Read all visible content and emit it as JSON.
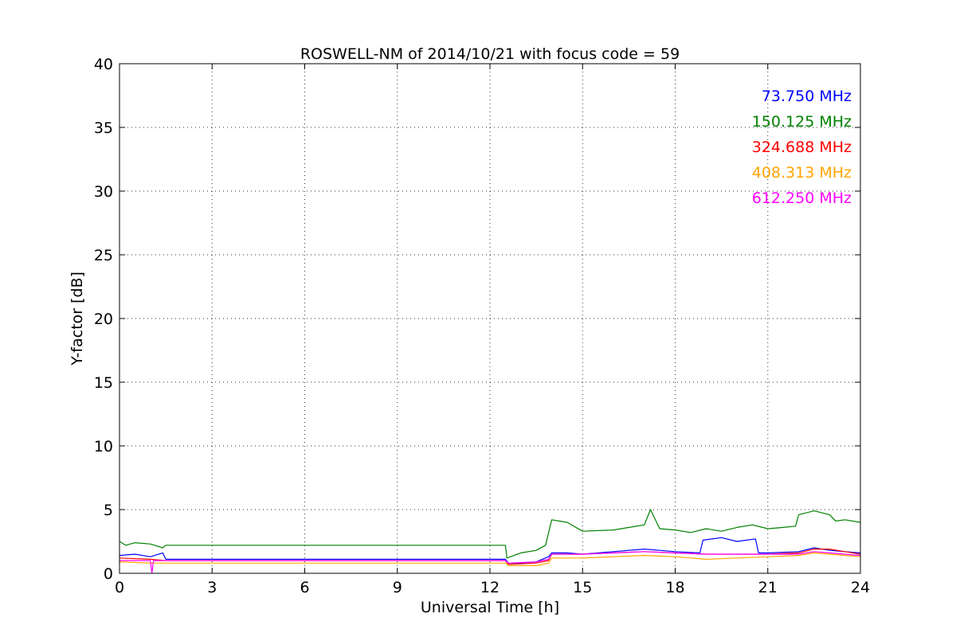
{
  "chart_data": {
    "type": "line",
    "title": "ROSWELL-NM of 2014/10/21 with focus code = 59",
    "xlabel": "Universal Time [h]",
    "ylabel": "Y-factor [dB]",
    "xlim": [
      0,
      24
    ],
    "ylim": [
      0,
      40
    ],
    "xticks": [
      0,
      3,
      6,
      9,
      12,
      15,
      18,
      21,
      24
    ],
    "yticks": [
      0,
      5,
      10,
      15,
      20,
      25,
      30,
      35,
      40
    ],
    "xtick_labels": [
      "0",
      "3",
      "6",
      "9",
      "12",
      "15",
      "18",
      "21",
      "24"
    ],
    "ytick_labels": [
      "0",
      "5",
      "10",
      "15",
      "20",
      "25",
      "30",
      "35",
      "40"
    ],
    "grid": true,
    "legend_position": "top-right",
    "series": [
      {
        "name": "73.750 MHz",
        "color": "#0000ff",
        "x": [
          0,
          0.5,
          1.0,
          1.4,
          1.5,
          12.5,
          12.6,
          13.0,
          13.5,
          13.9,
          14.0,
          14.5,
          15.0,
          16.0,
          17.0,
          17.5,
          18.0,
          18.8,
          18.9,
          19.5,
          20.0,
          20.6,
          20.7,
          21.0,
          22.0,
          22.5,
          23.0,
          23.5,
          24.0
        ],
        "y": [
          1.4,
          1.5,
          1.3,
          1.6,
          1.1,
          1.1,
          0.8,
          0.8,
          0.9,
          1.3,
          1.6,
          1.6,
          1.5,
          1.7,
          1.9,
          1.8,
          1.7,
          1.6,
          2.6,
          2.8,
          2.5,
          2.7,
          1.6,
          1.6,
          1.7,
          2.0,
          1.8,
          1.7,
          1.6
        ]
      },
      {
        "name": "150.125 MHz",
        "color": "#008000",
        "x": [
          0,
          0.2,
          0.5,
          1.0,
          1.4,
          1.5,
          12.5,
          12.55,
          13.0,
          13.5,
          13.8,
          14.0,
          14.5,
          15.0,
          16.0,
          16.5,
          17.0,
          17.2,
          17.5,
          18.0,
          18.5,
          19.0,
          19.5,
          20.0,
          20.5,
          21.0,
          21.5,
          21.9,
          22.0,
          22.5,
          23.0,
          23.2,
          23.5,
          24.0
        ],
        "y": [
          2.5,
          2.2,
          2.4,
          2.3,
          2.0,
          2.2,
          2.2,
          1.2,
          1.6,
          1.8,
          2.2,
          4.2,
          4.0,
          3.3,
          3.4,
          3.6,
          3.8,
          5.0,
          3.5,
          3.4,
          3.2,
          3.5,
          3.3,
          3.6,
          3.8,
          3.5,
          3.6,
          3.7,
          4.6,
          4.9,
          4.6,
          4.1,
          4.2,
          4.0
        ]
      },
      {
        "name": "324.688 MHz",
        "color": "#ff0000",
        "x": [
          0,
          1.0,
          1.5,
          12.5,
          12.6,
          13.5,
          13.9,
          14.0,
          15.0,
          16.0,
          17.0,
          18.0,
          19.0,
          20.0,
          21.0,
          22.0,
          22.5,
          23.0,
          23.5,
          24.0
        ],
        "y": [
          1.2,
          1.1,
          1.0,
          1.0,
          0.7,
          0.8,
          1.0,
          1.5,
          1.5,
          1.6,
          1.7,
          1.6,
          1.5,
          1.5,
          1.5,
          1.6,
          1.9,
          1.9,
          1.7,
          1.5
        ]
      },
      {
        "name": "408.313 MHz",
        "color": "#ffa500",
        "x": [
          0,
          1.0,
          1.5,
          12.5,
          12.6,
          13.5,
          13.9,
          14.0,
          15.0,
          16.0,
          17.0,
          18.0,
          19.0,
          20.0,
          21.0,
          22.0,
          22.5,
          23.0,
          23.5,
          24.0
        ],
        "y": [
          0.9,
          0.8,
          0.8,
          0.8,
          0.6,
          0.6,
          0.8,
          1.2,
          1.2,
          1.3,
          1.4,
          1.3,
          1.1,
          1.2,
          1.3,
          1.4,
          1.6,
          1.5,
          1.4,
          1.3
        ]
      },
      {
        "name": "612.250 MHz",
        "color": "#ff00ff",
        "x": [
          0,
          1.0,
          1.05,
          1.1,
          1.5,
          12.5,
          12.6,
          13.5,
          13.9,
          14.0,
          15.0,
          16.0,
          17.0,
          18.0,
          19.0,
          20.0,
          21.0,
          22.0,
          22.5,
          23.0,
          23.5,
          24.0
        ],
        "y": [
          1.0,
          1.0,
          0.0,
          1.0,
          1.0,
          1.0,
          0.8,
          0.9,
          1.1,
          1.5,
          1.5,
          1.6,
          1.7,
          1.6,
          1.5,
          1.5,
          1.5,
          1.5,
          1.7,
          1.6,
          1.5,
          1.4
        ]
      }
    ]
  }
}
